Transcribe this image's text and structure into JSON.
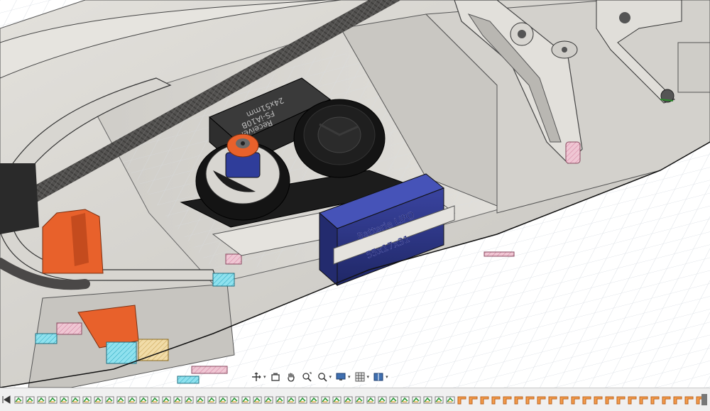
{
  "model": {
    "receiver_label_line1": "Receiver",
    "receiver_label_line2": "FS-iA10B",
    "receiver_label_line3": "24x51mm",
    "battery_label_line1": "Batterie LIPO",
    "battery_label_line2": "55x17x31"
  },
  "colors": {
    "canvas_bg": "#ffffff",
    "grid_line": "#d9dee4",
    "body_shell": "#d6d4cf",
    "body_shadow": "#9e9c97",
    "carbon_tube": "#5e5c5a",
    "battery_blue": "#28317a",
    "servo_black": "#1c1c1c",
    "accent_orange": "#e8612b",
    "section_pink": "#e7b1c3",
    "section_cyan": "#6fd6e6"
  },
  "navigation_toolbar": [
    {
      "icon": "orbit-icon"
    },
    {
      "icon": "look-at-icon"
    },
    {
      "icon": "pan-hand-icon"
    },
    {
      "icon": "zoom-fit-icon"
    },
    {
      "icon": "zoom-window-icon"
    },
    {
      "icon": "display-settings-icon"
    },
    {
      "icon": "grid-settings-icon"
    },
    {
      "icon": "viewports-icon"
    }
  ],
  "timeline": {
    "features": [
      "sketch",
      "sketch",
      "sketch",
      "sketch",
      "sketch",
      "sketch",
      "sketch",
      "sketch",
      "sketch",
      "sketch",
      "sketch",
      "sketch",
      "sketch",
      "sketch",
      "sketch",
      "sketch",
      "sketch",
      "sketch",
      "sketch",
      "sketch",
      "sketch",
      "sketch",
      "sketch",
      "sketch",
      "sketch",
      "sketch",
      "sketch",
      "sketch",
      "sketch",
      "sketch",
      "sketch",
      "sketch",
      "sketch",
      "sketch",
      "sketch",
      "sketch",
      "sketch",
      "sketch",
      "sketch",
      "fillet",
      "fillet",
      "fillet",
      "fillet",
      "fillet",
      "fillet",
      "fillet",
      "fillet",
      "fillet",
      "fillet",
      "fillet",
      "fillet",
      "fillet",
      "fillet",
      "fillet",
      "fillet",
      "fillet",
      "fillet",
      "fillet",
      "fillet",
      "fillet",
      "fillet",
      "fillet",
      "fillet",
      "fillet",
      "fillet",
      "fillet",
      "fillet",
      "fillet",
      "fillet",
      "fillet",
      "fillet",
      "fillet",
      "fillet",
      "fillet",
      "fillet",
      "fillet",
      "fillet",
      "fillet",
      "fillet",
      "fillet",
      "fillet",
      "fillet",
      "fillet",
      "fillet",
      "fillet",
      "fillet",
      "fillet",
      "fillet",
      "fillet",
      "fillet",
      "fillet",
      "fillet",
      "fillet",
      "fillet",
      "fillet",
      "fillet",
      "fillet",
      "fillet",
      "fillet",
      "fillet",
      "fillet",
      "fillet",
      "fillet",
      "fillet",
      "fillet",
      "fillet",
      "fillet",
      "fillet",
      "fillet",
      "fillet",
      "fillet",
      "fillet",
      "fillet",
      "fillet",
      "fillet",
      "fillet",
      "fillet",
      "fillet",
      "fillet",
      "fillet",
      "fillet",
      "fillet"
    ]
  }
}
